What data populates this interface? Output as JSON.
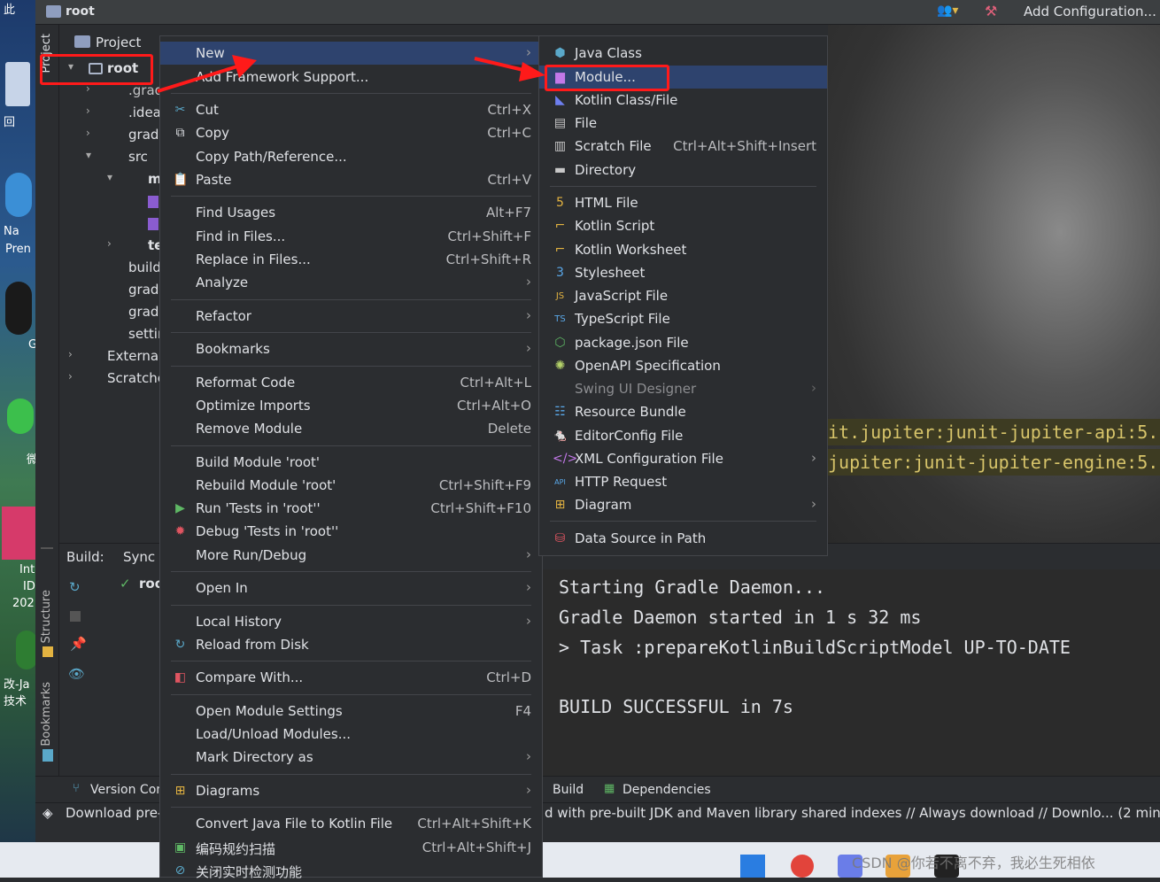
{
  "window": {
    "title": "root",
    "run_config": "Add Configuration..."
  },
  "desktop": {
    "items": [
      "此",
      "回",
      "Na",
      "Pren",
      "G",
      "微",
      "Int",
      "ID",
      "202",
      "改-Ja",
      "技术"
    ]
  },
  "sidebar": {
    "project_tab": "Project",
    "structure_tab": "Structure",
    "bookmarks_tab": "Bookmarks"
  },
  "project": {
    "header": "Project",
    "tree": [
      ".grad",
      ".idea",
      "gradl",
      "src",
      "m",
      "te",
      "build",
      "gradl",
      "gradl",
      "settir",
      "External",
      "Scratche"
    ],
    "root": "root"
  },
  "build": {
    "label": "Build:",
    "sync_tab": "Sync",
    "entry": "roo"
  },
  "context_menu": {
    "new": "New",
    "add_framework": "Add Framework Support...",
    "cut": "Cut",
    "cut_sc": "Ctrl+X",
    "copy": "Copy",
    "copy_sc": "Ctrl+C",
    "copy_path": "Copy Path/Reference...",
    "paste": "Paste",
    "paste_sc": "Ctrl+V",
    "find_usages": "Find Usages",
    "find_usages_sc": "Alt+F7",
    "find_files": "Find in Files...",
    "find_files_sc": "Ctrl+Shift+F",
    "replace_files": "Replace in Files...",
    "replace_files_sc": "Ctrl+Shift+R",
    "analyze": "Analyze",
    "refactor": "Refactor",
    "bookmarks": "Bookmarks",
    "reformat": "Reformat Code",
    "reformat_sc": "Ctrl+Alt+L",
    "optimize": "Optimize Imports",
    "optimize_sc": "Ctrl+Alt+O",
    "remove_module": "Remove Module",
    "remove_module_sc": "Delete",
    "build_module": "Build Module 'root'",
    "rebuild_module": "Rebuild Module 'root'",
    "rebuild_sc": "Ctrl+Shift+F9",
    "run_tests": "Run 'Tests in 'root''",
    "run_sc": "Ctrl+Shift+F10",
    "debug_tests": "Debug 'Tests in 'root''",
    "more_run": "More Run/Debug",
    "open_in": "Open In",
    "local_history": "Local History",
    "reload": "Reload from Disk",
    "compare": "Compare With...",
    "compare_sc": "Ctrl+D",
    "module_settings": "Open Module Settings",
    "module_settings_sc": "F4",
    "load_unload": "Load/Unload Modules...",
    "mark_dir": "Mark Directory as",
    "diagrams": "Diagrams",
    "convert": "Convert Java File to Kotlin File",
    "convert_sc": "Ctrl+Alt+Shift+K",
    "scan": "编码规约扫描",
    "scan_sc": "Ctrl+Alt+Shift+J",
    "realtime": "关闭实时检测功能"
  },
  "new_submenu": {
    "java_class": "Java Class",
    "module": "Module...",
    "kotlin_class": "Kotlin Class/File",
    "file": "File",
    "scratch": "Scratch File",
    "scratch_sc": "Ctrl+Alt+Shift+Insert",
    "directory": "Directory",
    "html": "HTML File",
    "kotlin_script": "Kotlin Script",
    "kotlin_worksheet": "Kotlin Worksheet",
    "stylesheet": "Stylesheet",
    "js": "JavaScript File",
    "ts": "TypeScript File",
    "package_json": "package.json File",
    "openapi": "OpenAPI Specification",
    "swing": "Swing UI Designer",
    "resource_bundle": "Resource Bundle",
    "editorconfig": "EditorConfig File",
    "xml": "XML Configuration File",
    "http": "HTTP Request",
    "diagram": "Diagram",
    "datasource": "Data Source in Path"
  },
  "editor": {
    "line1": "it.jupiter:junit-jupiter-api:5.",
    "line2": "jupiter:junit-jupiter-engine:5."
  },
  "console": {
    "l1": "Starting Gradle Daemon...",
    "l2": "Gradle Daemon started in 1 s 32 ms",
    "l3": "> Task :prepareKotlinBuildScriptModel UP-TO-DATE",
    "l4": "BUILD SUCCESSFUL in 7s"
  },
  "bottom": {
    "version_control": "Version Cont",
    "build_tab": "Build",
    "deps_tab": "Dependencies"
  },
  "status": {
    "download": "Download pre-",
    "message": "d with pre-built JDK and Maven library shared indexes // Always download // Downlo... (2 minute"
  },
  "watermark": "CSDN @你若不离不弃，我必生死相依",
  "colors": {
    "highlight": "#2e436e",
    "annotation": "#ff1a1a"
  }
}
